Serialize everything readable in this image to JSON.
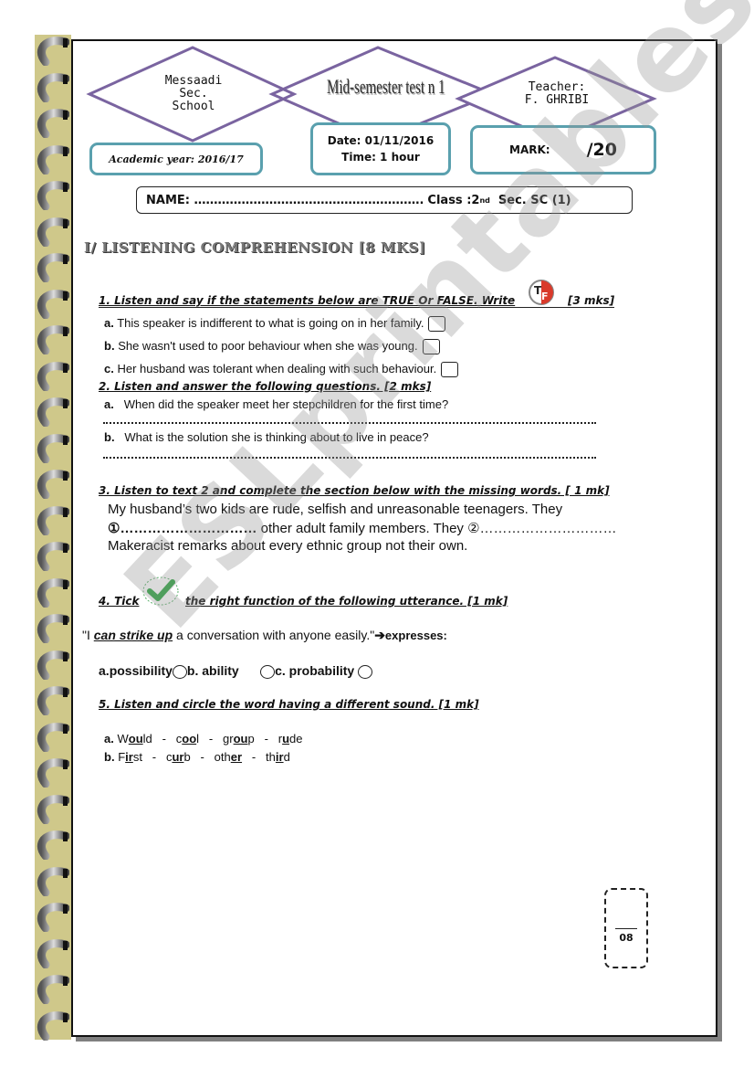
{
  "header": {
    "school": [
      "Messaadi",
      "Sec.",
      "School"
    ],
    "test_title": "Mid-semester test n 1",
    "teacher": [
      "Teacher:",
      "F. GHRIBI"
    ],
    "academic_year": "Academic year:  2016/17",
    "date": "Date: 01/11/2016",
    "time": "Time: 1 hour",
    "mark_label": "MARK:",
    "mark_value": "/20",
    "name_label": "NAME: ………………………………………………….",
    "class_label": "Class :2",
    "class_sup": "nd",
    "class_rest": "  Sec. SC (1)"
  },
  "section": {
    "title": "I/ LISTENING COMPREHENSION [8 MKS]"
  },
  "q1": {
    "title": "1. Listen and say if the statements below are TRUE Or FALSE. Write",
    "marks": "[3  mks]",
    "icon": "true-false-icon",
    "items": [
      {
        "letter": "a.",
        "text": "This speaker is indifferent to what is going on in her family."
      },
      {
        "letter": "b.",
        "text": "She wasn't used to poor behaviour when she was young."
      },
      {
        "letter": "c.",
        "text": "Her husband was tolerant when dealing with such behaviour."
      }
    ]
  },
  "q2": {
    "title": "2. Listen and answer the following questions. [2 mks]",
    "items": [
      {
        "letter": "a.",
        "text": "When did the speaker meet her stepchildren for the first time?"
      },
      {
        "letter": "b.",
        "text": "What is the solution she is thinking about to live in peace?"
      }
    ]
  },
  "q3": {
    "title": "3. Listen to text 2 and complete the section below with the missing words. [ 1 mk]",
    "line1": "My husband’s two kids are rude, selfish and unreasonable teenagers. They",
    "blank1": "①…………………………",
    "line2a": " other adult family members. They ",
    "blank2": "②…………………………",
    "line3": "Makeracist remarks about every ethnic group not their own."
  },
  "q4": {
    "title_a": "4. Tick",
    "title_b": "the right function of the following utterance. [1 mk]",
    "icon": "checkmark-icon",
    "quote_open": "\"I ",
    "quote_phrase": "can strike up",
    "quote_rest": " a conversation with anyone easily.\"",
    "arrow": "➔",
    "expresses": "expresses:",
    "options": [
      {
        "letter": "a.",
        "label": "possibility"
      },
      {
        "letter": "b.",
        "label": " ability"
      },
      {
        "letter": "c.",
        "label": " probability"
      }
    ]
  },
  "q5": {
    "title": "5. Listen and circle the word having a different sound. [1 mk]",
    "rows": [
      {
        "letter": "a.",
        "words": [
          [
            "W",
            "ou",
            "ld"
          ],
          [
            "c",
            "oo",
            "l"
          ],
          [
            "gr",
            "ou",
            "p"
          ],
          [
            "r",
            "u",
            "de"
          ]
        ]
      },
      {
        "letter": "b.",
        "words": [
          [
            "F",
            "ir",
            "st"
          ],
          [
            "c",
            "ur",
            "b"
          ],
          [
            "oth",
            "er",
            ""
          ],
          [
            "th",
            "ir",
            "d"
          ]
        ]
      }
    ]
  },
  "footer": {
    "page_score": "08"
  },
  "watermark": "ESLprintables.com"
}
